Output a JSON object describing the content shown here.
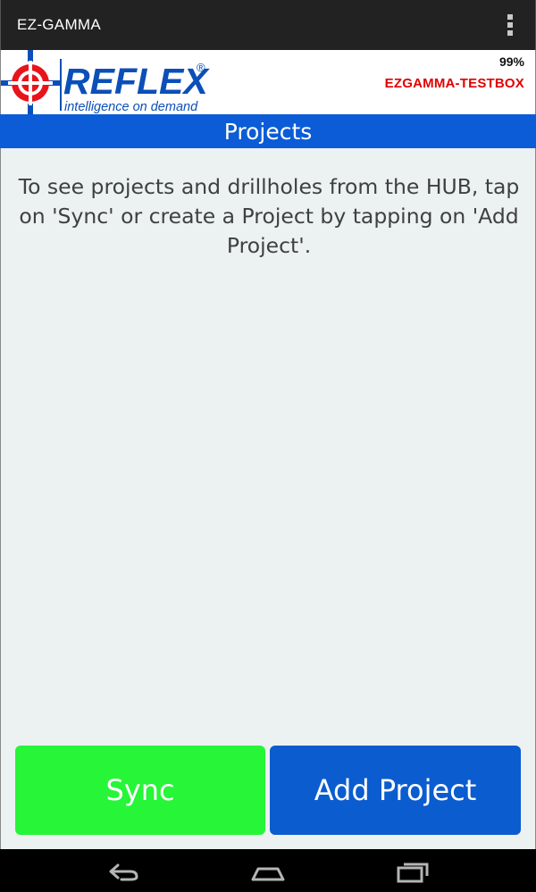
{
  "app_bar": {
    "title": "EZ-GAMMA",
    "overflow_icon": "overflow-menu-icon"
  },
  "brand": {
    "logo_word": "REFLEX",
    "logo_registered": "®",
    "logo_tagline": "intelligence on demand",
    "battery": "99%",
    "device_name": "EZGAMMA-TESTBOX",
    "device_name_color": "#e00000"
  },
  "header": {
    "title": "Projects",
    "color": "#0b5cd6"
  },
  "content": {
    "message": "To see projects and drillholes from the HUB, tap on 'Sync' or create a Project by tapping on 'Add Project'."
  },
  "buttons": {
    "sync": {
      "label": "Sync",
      "color": "#26f538"
    },
    "add_project": {
      "label": "Add Project",
      "color": "#0b5ccf"
    }
  },
  "nav": {
    "back_icon": "back-icon",
    "home_icon": "home-icon",
    "recents_icon": "recents-icon"
  }
}
